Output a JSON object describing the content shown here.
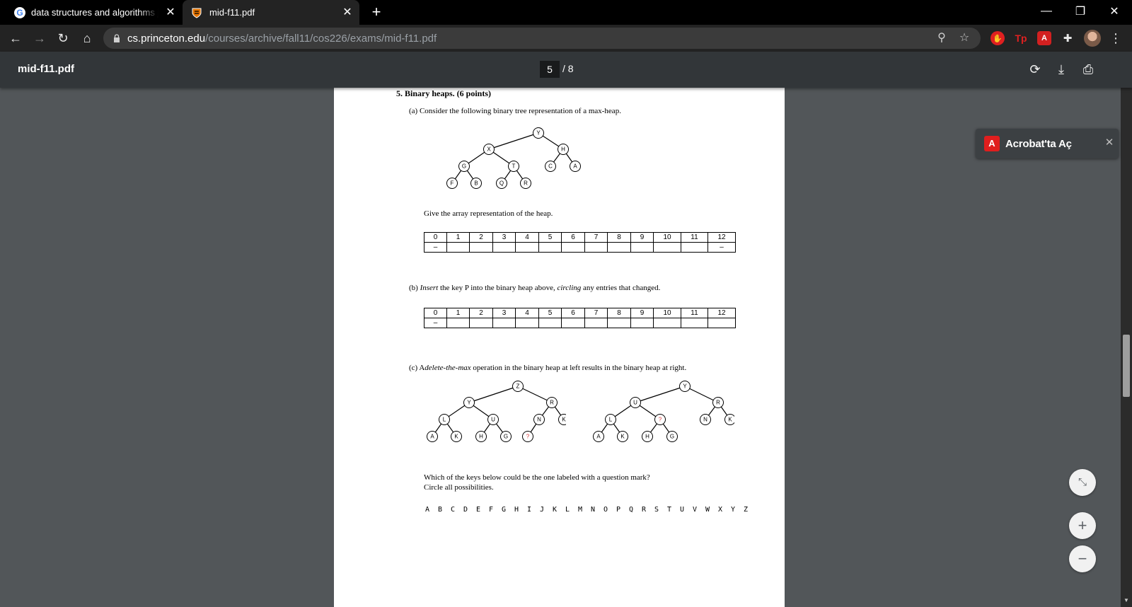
{
  "browser": {
    "tabs": [
      {
        "title": "data structures and algorithms ja"
      },
      {
        "title": "mid-f11.pdf"
      }
    ],
    "url_domain": "cs.princeton.edu",
    "url_path": "/courses/archive/fall11/cos226/exams/mid-f11.pdf"
  },
  "pdf_viewer": {
    "filename": "mid-f11.pdf",
    "current_page": "5",
    "page_sep": "/ 8"
  },
  "acrobat_prompt": {
    "label": "Acrobat'ta Aç"
  },
  "colors": {
    "tab_bg": "#000000",
    "toolbar_bg": "#232323",
    "pdfbar_bg": "#323639",
    "viewer_bg": "#525659",
    "acrobat_red": "#e01e1e",
    "question_mark_red": "#d43030"
  },
  "document": {
    "heading": "5. Binary heaps. (6 points)",
    "part_a": "(a) Consider the following binary tree representation of a max-heap.",
    "tree_a": {
      "root": "Y",
      "level1": [
        "X",
        "H"
      ],
      "level2": [
        "G",
        "T",
        "C",
        "A"
      ],
      "level3": [
        "F",
        "B",
        "Q",
        "R"
      ]
    },
    "give_array": "Give the array representation of the heap.",
    "table_indices": [
      "0",
      "1",
      "2",
      "3",
      "4",
      "5",
      "6",
      "7",
      "8",
      "9",
      "10",
      "11",
      "12"
    ],
    "table_a_row2": [
      "–",
      "",
      "",
      "",
      "",
      "",
      "",
      "",
      "",
      "",
      "",
      "",
      "–"
    ],
    "part_b_prefix": "(b) ",
    "part_b_emph1": "Insert",
    "part_b_mid": " the key P into the binary heap above, ",
    "part_b_emph2": "circling",
    "part_b_suffix": " any entries that changed.",
    "table_b_row2": [
      "–",
      "",
      "",
      "",
      "",
      "",
      "",
      "",
      "",
      "",
      "",
      "",
      ""
    ],
    "part_c_prefix": "(c) A",
    "part_c_emph": "delete-the-max",
    "part_c_suffix": " operation in the binary heap at left results in the binary heap at right.",
    "tree_c_left": {
      "root": "Z",
      "level1": [
        "Y",
        "R"
      ],
      "level2": [
        "L",
        "U",
        "N",
        "K"
      ],
      "level3": [
        "A",
        "K",
        "H",
        "G",
        "?"
      ]
    },
    "tree_c_right": {
      "root": "Y",
      "level1": [
        "U",
        "R"
      ],
      "level2": [
        "L",
        "?",
        "N",
        "K"
      ],
      "level3": [
        "A",
        "K",
        "H",
        "G"
      ]
    },
    "which_keys": "Which of the keys below could be the one labeled with a question mark?",
    "circle_all": "Circle all possibilities.",
    "alphabet": [
      "A",
      "B",
      "C",
      "D",
      "E",
      "F",
      "G",
      "H",
      "I",
      "J",
      "K",
      "L",
      "M",
      "N",
      "O",
      "P",
      "Q",
      "R",
      "S",
      "T",
      "U",
      "V",
      "W",
      "X",
      "Y",
      "Z"
    ]
  }
}
